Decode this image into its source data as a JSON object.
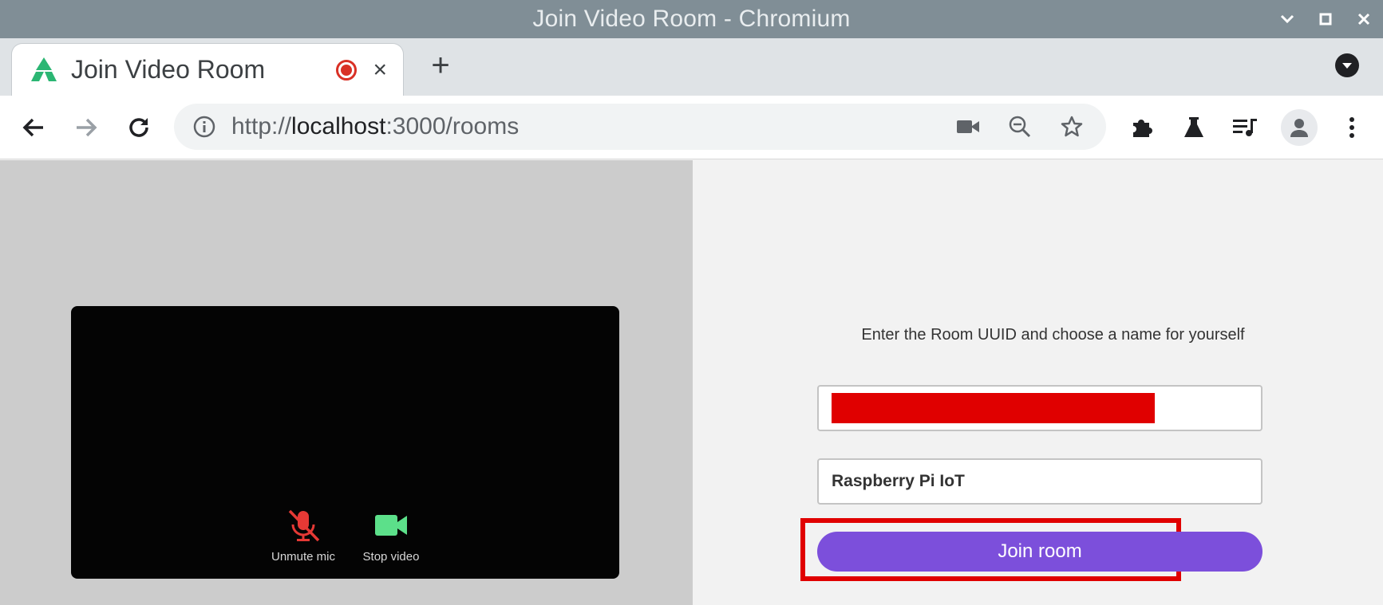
{
  "window": {
    "title": "Join Video Room - Chromium"
  },
  "tab": {
    "title": "Join Video Room",
    "close_glyph": "×"
  },
  "newtab_glyph": "+",
  "address_bar": {
    "scheme": "http://",
    "host": "localhost",
    "rest": ":3000/rooms"
  },
  "video_controls": {
    "mic_label": "Unmute mic",
    "video_label": "Stop video"
  },
  "form": {
    "instructions": "Enter the Room UUID and choose a name for yourself",
    "name_value": "Raspberry Pi IoT",
    "join_label": "Join room"
  },
  "colors": {
    "join_button": "#7c4fdb",
    "highlight": "#e00000",
    "mic_muted": "#e53935",
    "camera_on": "#5ce08a"
  },
  "icons": [
    "back-icon",
    "forward-icon",
    "reload-icon",
    "info-icon",
    "camera-icon",
    "zoom-out-icon",
    "star-icon",
    "extensions-icon",
    "labs-icon",
    "media-icon",
    "profile-icon",
    "menu-icon",
    "mic-off-icon",
    "video-camera-icon"
  ]
}
